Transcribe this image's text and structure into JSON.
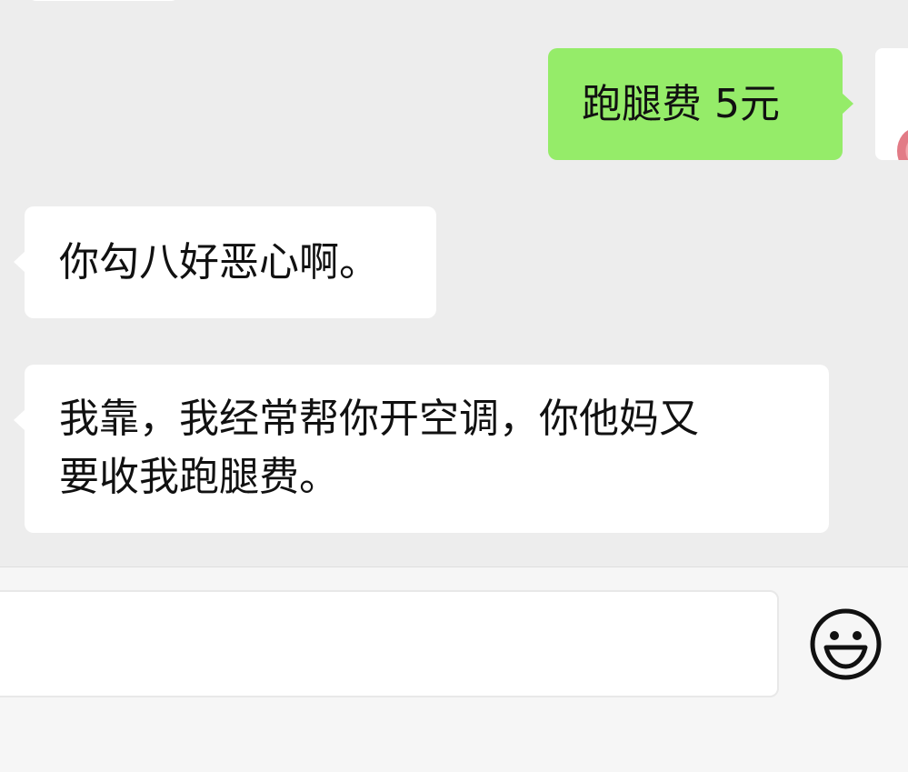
{
  "messages": [
    {
      "direction": "outgoing",
      "text": "跑腿费 5元"
    },
    {
      "direction": "incoming",
      "text": "你勾八好恶心啊。"
    },
    {
      "direction": "incoming",
      "text": "我靠，我经常帮你开空调，你他妈又\n要收我跑腿费。"
    }
  ],
  "icons": {
    "emoji_button": "smiley-icon",
    "avatar": "avatar-icon"
  },
  "colors": {
    "chat_background": "#ededed",
    "outgoing_bubble": "#95ec69",
    "incoming_bubble": "#ffffff",
    "input_bar": "#f6f6f6",
    "text": "#111111"
  }
}
